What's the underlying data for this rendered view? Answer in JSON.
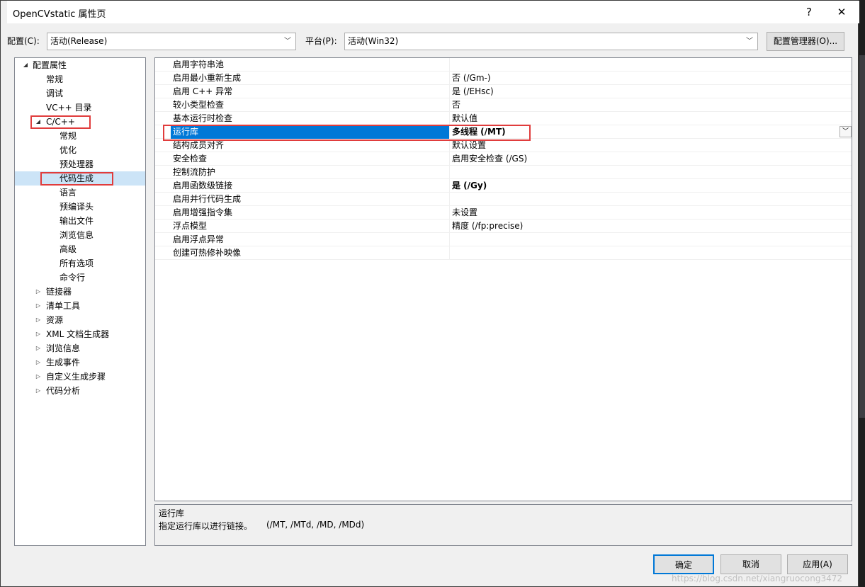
{
  "window": {
    "title": "OpenCVstatic 属性页",
    "help": "?",
    "close": "✕"
  },
  "config": {
    "label": "配置(C):",
    "value": "活动(Release)"
  },
  "platform": {
    "label": "平台(P):",
    "value": "活动(Win32)"
  },
  "config_manager": "配置管理器(O)...",
  "tree": [
    {
      "label": "配置属性",
      "toggle": "◢"
    },
    {
      "label": "常规"
    },
    {
      "label": "调试"
    },
    {
      "label": "VC++ 目录"
    },
    {
      "label": "C/C++",
      "toggle": "◢"
    },
    {
      "label": "常规"
    },
    {
      "label": "优化"
    },
    {
      "label": "预处理器"
    },
    {
      "label": "代码生成"
    },
    {
      "label": "语言"
    },
    {
      "label": "预编译头"
    },
    {
      "label": "输出文件"
    },
    {
      "label": "浏览信息"
    },
    {
      "label": "高级"
    },
    {
      "label": "所有选项"
    },
    {
      "label": "命令行"
    },
    {
      "label": "链接器",
      "toggle": "▷"
    },
    {
      "label": "清单工具",
      "toggle": "▷"
    },
    {
      "label": "资源",
      "toggle": "▷"
    },
    {
      "label": "XML 文档生成器",
      "toggle": "▷"
    },
    {
      "label": "浏览信息",
      "toggle": "▷"
    },
    {
      "label": "生成事件",
      "toggle": "▷"
    },
    {
      "label": "自定义生成步骤",
      "toggle": "▷"
    },
    {
      "label": "代码分析",
      "toggle": "▷"
    }
  ],
  "grid": [
    {
      "name": "启用字符串池",
      "value": ""
    },
    {
      "name": "启用最小重新生成",
      "value": "否 (/Gm-)"
    },
    {
      "name": "启用 C++ 异常",
      "value": "是 (/EHsc)"
    },
    {
      "name": "较小类型检查",
      "value": "否"
    },
    {
      "name": "基本运行时检查",
      "value": "默认值"
    },
    {
      "name": "运行库",
      "value": "多线程 (/MT)"
    },
    {
      "name": "结构成员对齐",
      "value": "默认设置"
    },
    {
      "name": "安全检查",
      "value": "启用安全检查 (/GS)"
    },
    {
      "name": "控制流防护",
      "value": ""
    },
    {
      "name": "启用函数级链接",
      "value": "是 (/Gy)"
    },
    {
      "name": "启用并行代码生成",
      "value": ""
    },
    {
      "name": "启用增强指令集",
      "value": "未设置"
    },
    {
      "name": "浮点模型",
      "value": "精度 (/fp:precise)"
    },
    {
      "name": "启用浮点异常",
      "value": ""
    },
    {
      "name": "创建可热修补映像",
      "value": ""
    }
  ],
  "description": {
    "title": "运行库",
    "text": "指定运行库以进行链接。",
    "switches": "(/MT, /MTd, /MD, /MDd)"
  },
  "buttons": {
    "ok": "确定",
    "cancel": "取消",
    "apply": "应用(A)"
  },
  "watermark": "https://blog.csdn.net/xiangruocong3472",
  "colors": {
    "selection": "#0078d7",
    "highlight": "#e03c3c"
  }
}
